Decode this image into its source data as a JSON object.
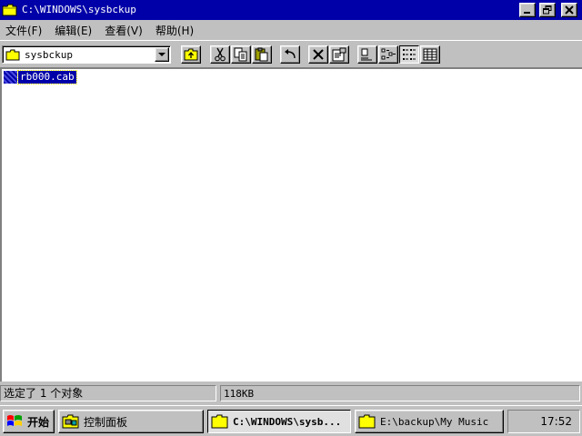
{
  "window": {
    "title": "C:\\WINDOWS\\sysbckup"
  },
  "menu": {
    "items": [
      {
        "label": "文件(F)"
      },
      {
        "label": "编辑(E)"
      },
      {
        "label": "查看(V)"
      },
      {
        "label": "帮助(H)"
      }
    ]
  },
  "toolbar": {
    "address_value": "sysbckup",
    "buttons": [
      "up-folder-icon",
      "cut-icon",
      "copy-icon",
      "paste-icon",
      "undo-icon",
      "delete-icon",
      "properties-icon",
      "large-icons-icon",
      "small-icons-icon",
      "list-view-icon",
      "details-view-icon"
    ]
  },
  "content": {
    "files": [
      {
        "name": "rb000.cab",
        "selected": true
      }
    ]
  },
  "status": {
    "left": "选定了 1 个对象",
    "right": "118KB"
  },
  "taskbar": {
    "start_label": "开始",
    "tasks": [
      {
        "label": "控制面板",
        "active": false
      },
      {
        "label": "C:\\WINDOWS\\sysb...",
        "active": true
      },
      {
        "label": "E:\\backup\\My Music",
        "active": false
      }
    ],
    "clock": "17:52"
  },
  "colors": {
    "titlebar": "#0000a8",
    "face": "#c0c0c0",
    "selection": "#0000a8",
    "folder": "#ffff00"
  }
}
